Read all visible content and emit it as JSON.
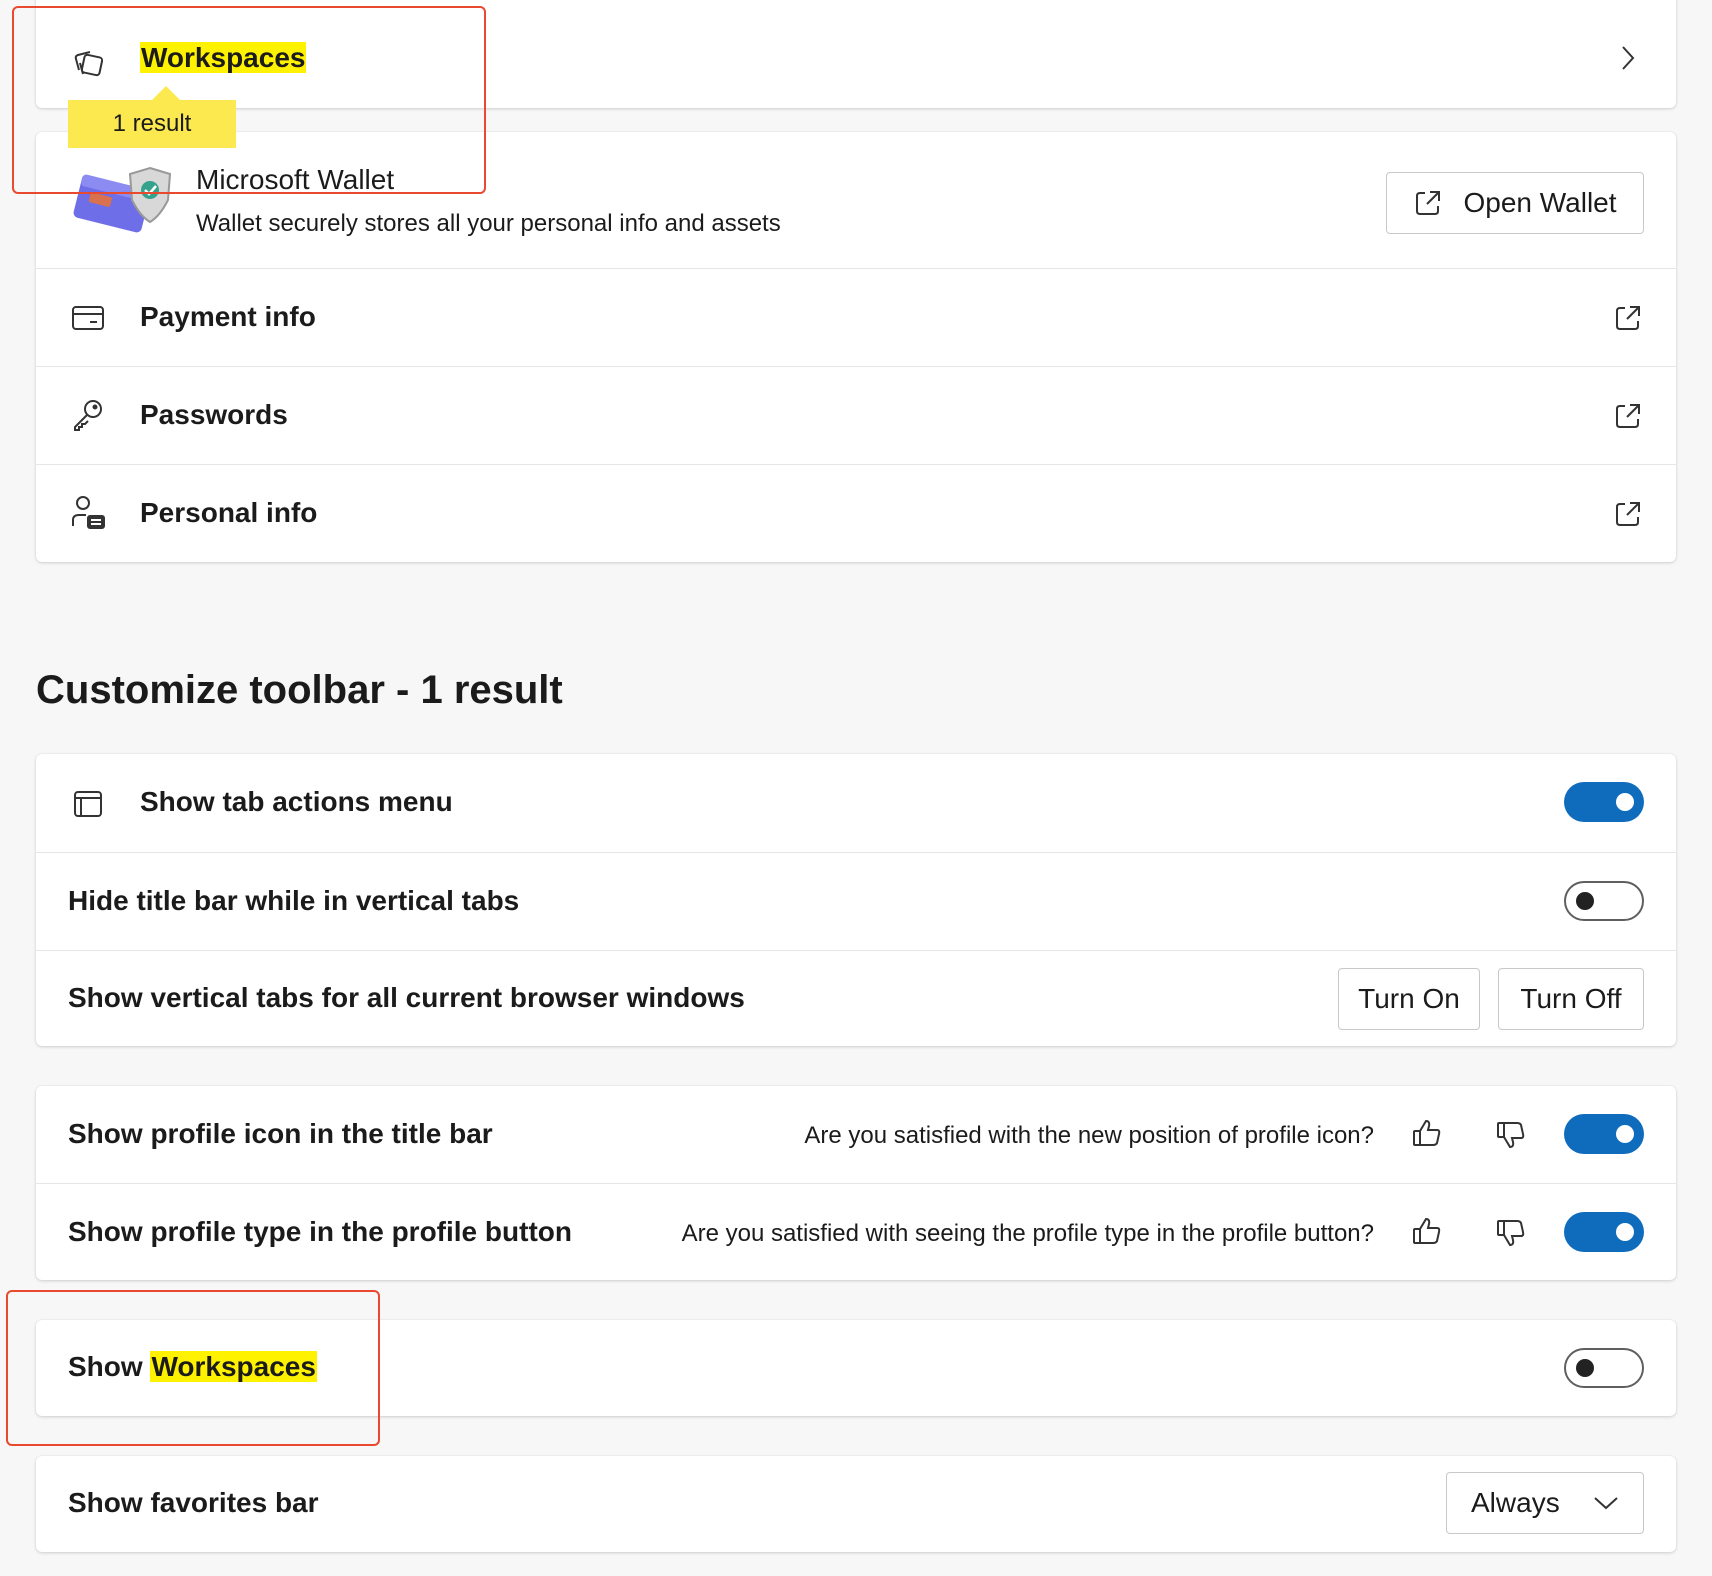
{
  "workspaces_card": {
    "label": "Workspaces",
    "tooltip": "1 result",
    "icon": "workspaces-icon",
    "chevron": "chevron-right-icon"
  },
  "wallet_card": {
    "title": "Microsoft Wallet",
    "description": "Wallet securely stores all your personal info and assets",
    "open_button": "Open Wallet",
    "items": [
      {
        "label": "Payment info",
        "icon": "credit-card-icon"
      },
      {
        "label": "Passwords",
        "icon": "key-icon"
      },
      {
        "label": "Personal info",
        "icon": "person-card-icon"
      }
    ]
  },
  "toolbar_section": {
    "title": "Customize toolbar - 1 result",
    "tab_actions": {
      "label": "Show tab actions menu",
      "state": "on"
    },
    "hide_title_bar": {
      "label": "Hide title bar while in vertical tabs",
      "state": "off"
    },
    "vertical_tabs": {
      "label": "Show vertical tabs for all current browser windows",
      "turn_on": "Turn On",
      "turn_off": "Turn Off"
    },
    "profile_icon": {
      "label": "Show profile icon in the title bar",
      "question": "Are you satisfied with the new position of profile icon?",
      "state": "on"
    },
    "profile_type": {
      "label": "Show profile type in the profile button",
      "question": "Are you satisfied with seeing the profile type in the profile button?",
      "state": "on"
    },
    "show_workspaces": {
      "label_prefix": "Show",
      "label_highlight": "Workspaces",
      "state": "off"
    },
    "favorites_bar": {
      "label": "Show favorites bar",
      "selected": "Always"
    }
  },
  "colors": {
    "accent": "#0f6cbd",
    "highlight": "#fff200",
    "annotation": "#e8492f"
  }
}
